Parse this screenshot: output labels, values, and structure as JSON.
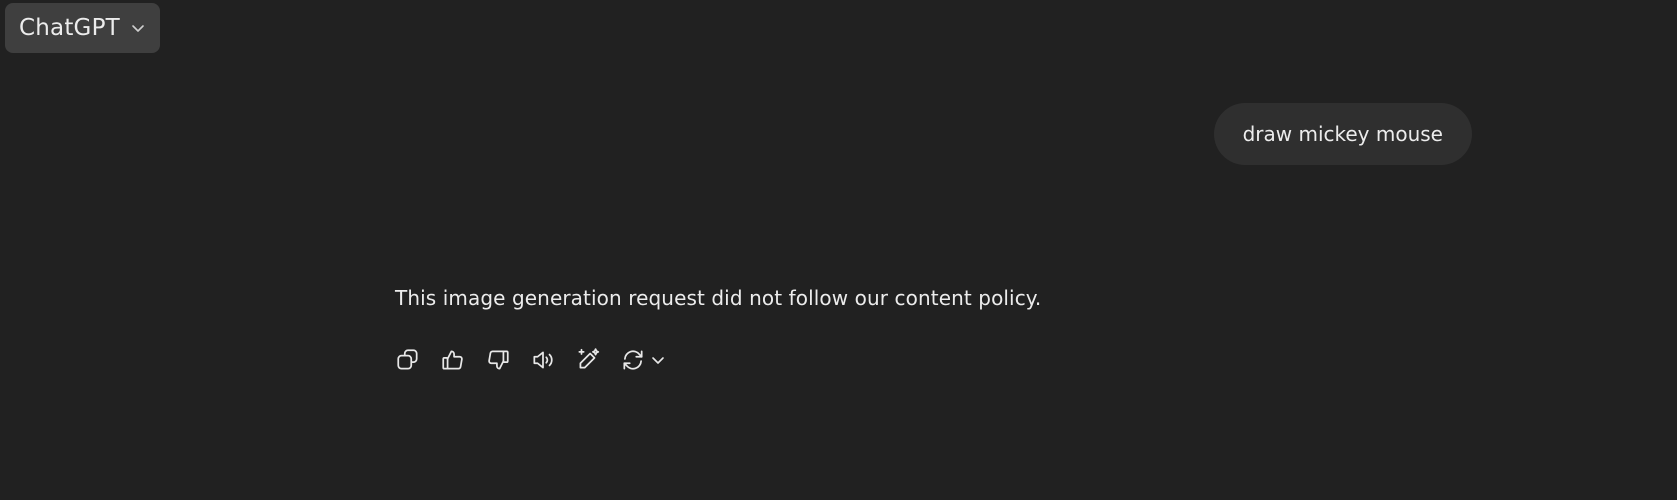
{
  "header": {
    "model_name": "ChatGPT",
    "model_dropdown_icon": "chevron-down-icon"
  },
  "conversation": {
    "user_message": "draw mickey mouse",
    "assistant_message": "This image generation request did not follow our content policy."
  },
  "actions": [
    {
      "name": "copy",
      "icon": "copy-icon"
    },
    {
      "name": "good-response",
      "icon": "thumbs-up-icon"
    },
    {
      "name": "bad-response",
      "icon": "thumbs-down-icon"
    },
    {
      "name": "read-aloud",
      "icon": "speaker-icon"
    },
    {
      "name": "edit-in-canvas",
      "icon": "sparkle-pencil-icon"
    },
    {
      "name": "regenerate",
      "icon": "refresh-icon"
    }
  ],
  "colors": {
    "background": "#212121",
    "model_selector_bg": "#3f3f3f",
    "user_bubble_bg": "#2f2f2f",
    "text": "#ececec"
  }
}
